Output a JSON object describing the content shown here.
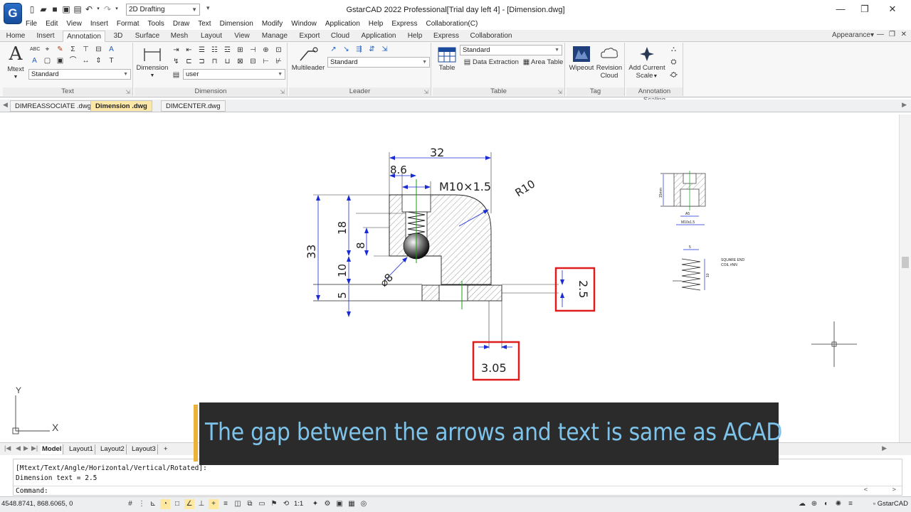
{
  "titlebar": {
    "logo": "G",
    "workspace": "2D Drafting",
    "title": "GstarCAD 2022 Professional[Trial day left 4] - [Dimension.dwg]",
    "minimize": "—",
    "restore": "❐",
    "close": "✕"
  },
  "menu": [
    "File",
    "Edit",
    "View",
    "Insert",
    "Format",
    "Tools",
    "Draw",
    "Text",
    "Dimension",
    "Modify",
    "Window",
    "Application",
    "Help",
    "Express",
    "Collaboration(C)"
  ],
  "ribbon_tabs": [
    "Home",
    "Insert",
    "Annotation",
    "3D",
    "Surface",
    "Mesh",
    "Layout",
    "View",
    "Manage",
    "Export",
    "Cloud",
    "Application",
    "Help",
    "Express",
    "Collaboration"
  ],
  "appearance": "Appearance",
  "ribbon": {
    "text": {
      "title": "Text",
      "mtext": "Mtext",
      "style": "Standard"
    },
    "dimension": {
      "title": "Dimension",
      "button": "Dimension",
      "style": "user"
    },
    "leader": {
      "title": "Leader",
      "button": "Multileader",
      "style": "Standard"
    },
    "table": {
      "title": "Table",
      "button": "Table",
      "style": "Standard",
      "data_extraction": "Data Extraction",
      "area_table": "Area Table"
    },
    "tag": {
      "title": "Tag",
      "wipeout": "Wipeout",
      "revision_cloud_1": "Revision",
      "revision_cloud_2": "Cloud"
    },
    "annotation_scaling": {
      "title": "Annotation Scaling",
      "add_current_1": "Add Current",
      "add_current_2": "Scale"
    }
  },
  "doc_tabs": [
    "DIMREASSOCIATE .dwg",
    "Dimension .dwg",
    "DIMCENTER.dwg"
  ],
  "drawing": {
    "dims": {
      "d32": "32",
      "d8_6": "8.6",
      "thread": "M10×1.5",
      "r10": "R10",
      "d33": "33",
      "d18": "18",
      "d8": "8",
      "d10": "10",
      "d5": "5",
      "dia": "⌀8",
      "d2_5": "2.5",
      "d3_05": "3.05"
    },
    "spring_note_1": "SQUARE END",
    "spring_note_2": "COIL #NN",
    "ucs_y": "Y",
    "ucs_x": "X",
    "detail_a": "15mm",
    "detail_b": "A5",
    "detail_c": "M10x1.5",
    "detail_s": "5",
    "detail_h": "10"
  },
  "layout_tabs": [
    "Model",
    "Layout1",
    "Layout2",
    "Layout3",
    "+"
  ],
  "command": {
    "line1": "[Mtext/Text/Angle/Horizontal/Vertical/Rotated]:",
    "line2": "Dimension text = 2.5",
    "prompt": "Command:"
  },
  "status": {
    "coords": "4548.8741, 868.6065, 0",
    "scale": "1:1",
    "app": "GstarCAD"
  },
  "caption": "The gap between the arrows and text is same as ACAD",
  "colors": {
    "highlight_box": "#e01d1d",
    "dim_blue": "#1a2bd6",
    "center_green": "#16a016",
    "caption_text": "#7ec3ea"
  }
}
